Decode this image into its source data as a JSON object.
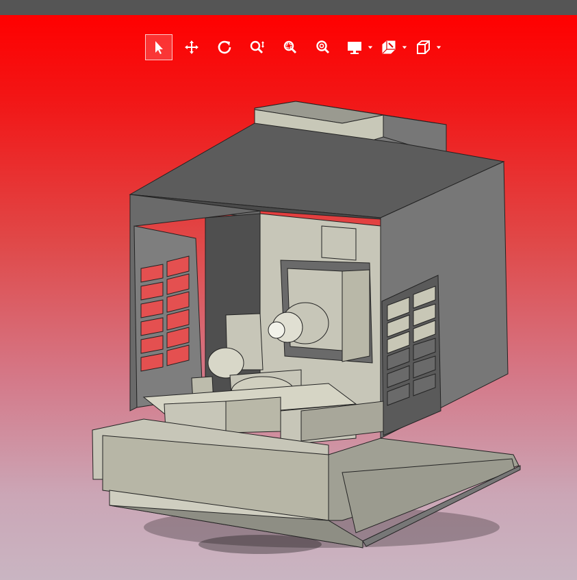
{
  "colors": {
    "topbar": "#555555",
    "viewport_top": "#ff0000",
    "viewport_bottom": "#c9b5c2",
    "machine_casing": "#6c6c6c",
    "machine_light": "#b8b8a6",
    "window_red": "#e45050"
  },
  "toolbar": {
    "tools": [
      {
        "icon": "select-arrow-icon",
        "active": true
      },
      {
        "icon": "pan-move-icon",
        "active": false
      },
      {
        "icon": "rotate-icon",
        "active": false
      },
      {
        "icon": "zoom-in-out-icon",
        "active": false
      },
      {
        "icon": "zoom-window-icon",
        "active": false
      },
      {
        "icon": "zoom-fit-icon",
        "active": false
      }
    ],
    "dropdowns": [
      {
        "icon": "display-monitor-icon"
      },
      {
        "icon": "section-cut-icon"
      },
      {
        "icon": "view-cube-icon"
      }
    ]
  },
  "viewport": {
    "content": "3d-model-cnc-machine"
  }
}
